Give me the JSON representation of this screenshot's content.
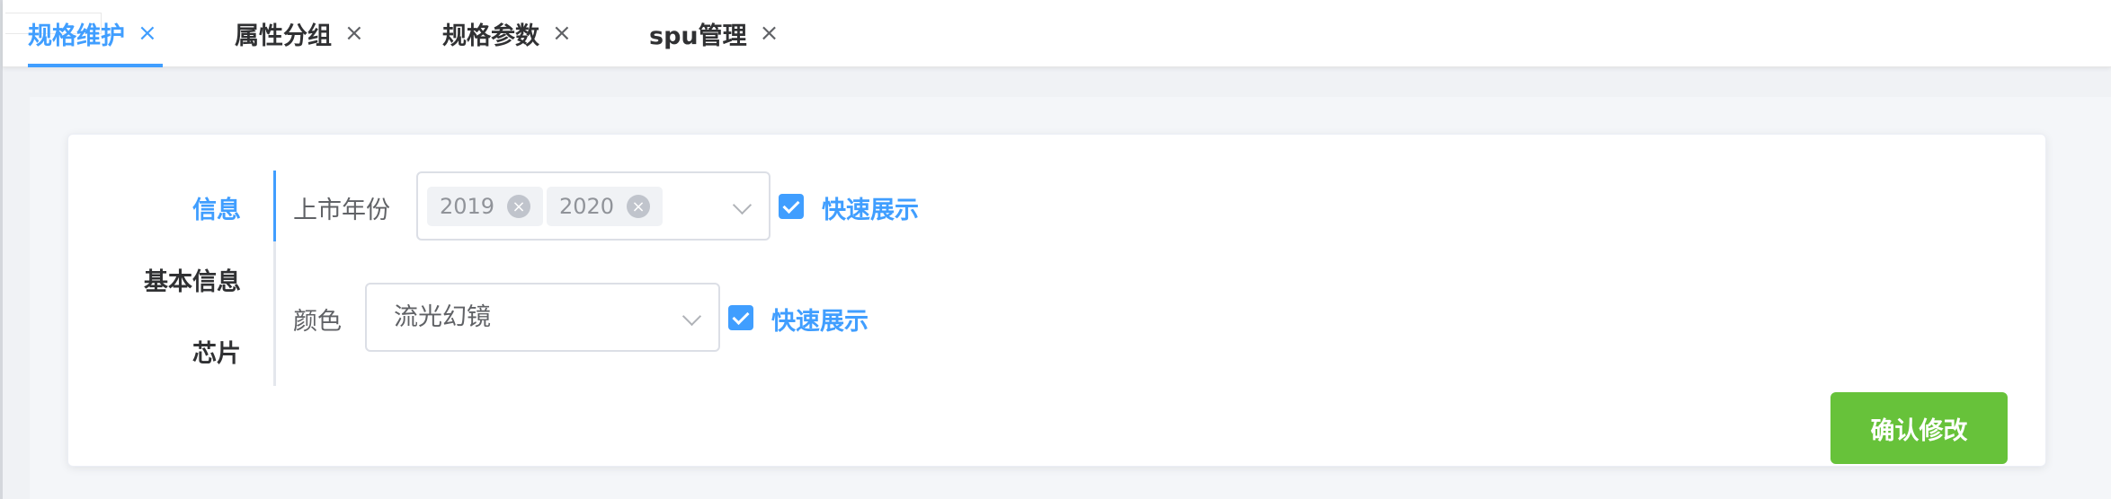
{
  "tabs": [
    {
      "label": "规格维护",
      "active": true
    },
    {
      "label": "属性分组",
      "active": false
    },
    {
      "label": "规格参数",
      "active": false
    },
    {
      "label": "spu管理",
      "active": false
    }
  ],
  "tab_close_glyph": "×",
  "side_tabs": [
    {
      "label": "信息",
      "active": true
    },
    {
      "label": "基本信息",
      "active": false
    },
    {
      "label": "芯片",
      "active": false
    }
  ],
  "form": {
    "year": {
      "label": "上市年份",
      "tags": [
        "2019",
        "2020"
      ],
      "quick_show_label": "快速展示",
      "quick_show_checked": true
    },
    "color": {
      "label": "颜色",
      "value": "流光幻镜",
      "quick_show_label": "快速展示",
      "quick_show_checked": true
    }
  },
  "confirm_button": "确认修改",
  "colors": {
    "primary": "#409eff",
    "success": "#67c23a",
    "text": "#303133",
    "muted": "#909399"
  }
}
